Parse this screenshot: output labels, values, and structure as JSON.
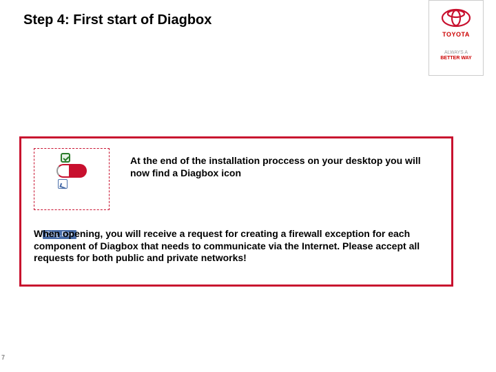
{
  "title": "Step 4: First start of Diagbox",
  "logo": {
    "name": "TOYOTA",
    "tagline_top": "ALWAYS A",
    "tagline_bottom": "BETTER WAY"
  },
  "icon": {
    "label": "Diag.Box",
    "semantic": "diagbox-desktop-shortcut"
  },
  "paragraphs": {
    "intro": "At the end of the installation proccess on your desktop you will now find a Diagbox icon",
    "body": "When opening, you will receive a request for creating a firewall exception for each component of Diagbox that needs to communicate via the Internet. Please accept all requests for both public and private networks!"
  },
  "page_number": "7"
}
